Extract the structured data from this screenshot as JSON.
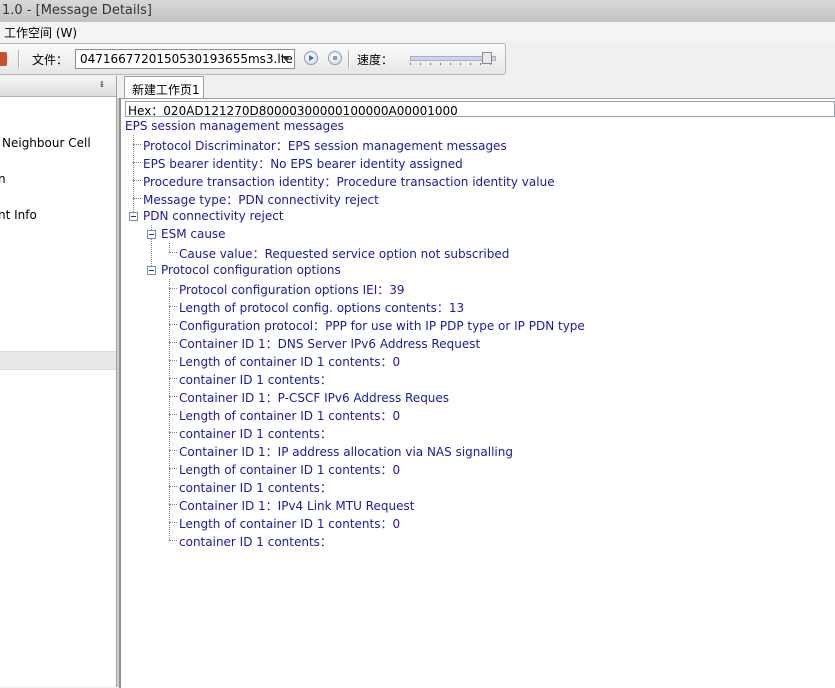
{
  "window": {
    "title": "1.0 - [Message Details]"
  },
  "menu": {
    "workspace": "工作空间 (W)"
  },
  "toolbar": {
    "file_label": "文件：",
    "file_value": "04716677201505301​93655ms3.lte",
    "speed_label": "速度：",
    "speed_level": 0.9
  },
  "left_panel": {
    "pin_glyph": "ᵻ",
    "items": [
      {
        "label": "Neighbour Cell"
      },
      {
        "label": "n"
      },
      {
        "label": "nt Info"
      }
    ]
  },
  "tabs": [
    {
      "label": "新建工作页1"
    }
  ],
  "tree": {
    "hex": "Hex：020AD121270D80000300000100000A00001000",
    "root": "EPS session management messages",
    "level1": [
      "Protocol Discriminator：EPS session management messages",
      "EPS bearer identity：No EPS bearer identity assigned",
      "Procedure transaction identity：Procedure transaction identity value",
      "Message type：PDN connectivity reject"
    ],
    "pdn": "PDN connectivity reject",
    "esm": "ESM cause",
    "cause": "Cause value：Requested service option not subscribed",
    "pco": "Protocol configuration options",
    "pco_items": [
      "Protocol configuration options IEI：39",
      "Length of protocol config. options contents：13",
      "Configuration protocol：PPP for use with IP PDP type or IP PDN type",
      "Container ID 1：DNS Server IPv6 Address Request",
      "Length of container ID 1 contents：0",
      "container ID 1 contents：",
      "Container ID 1：P-CSCF IPv6 Address Reques",
      "Length of container ID 1 contents：0",
      "container ID 1 contents：",
      "Container ID 1：IP address allocation via NAS signalling",
      "Length of container ID 1 contents：0",
      "container ID 1 contents：",
      "Container ID 1：IPv4 Link MTU Request",
      "Length of container ID 1 contents：0",
      "container ID 1 contents："
    ]
  }
}
